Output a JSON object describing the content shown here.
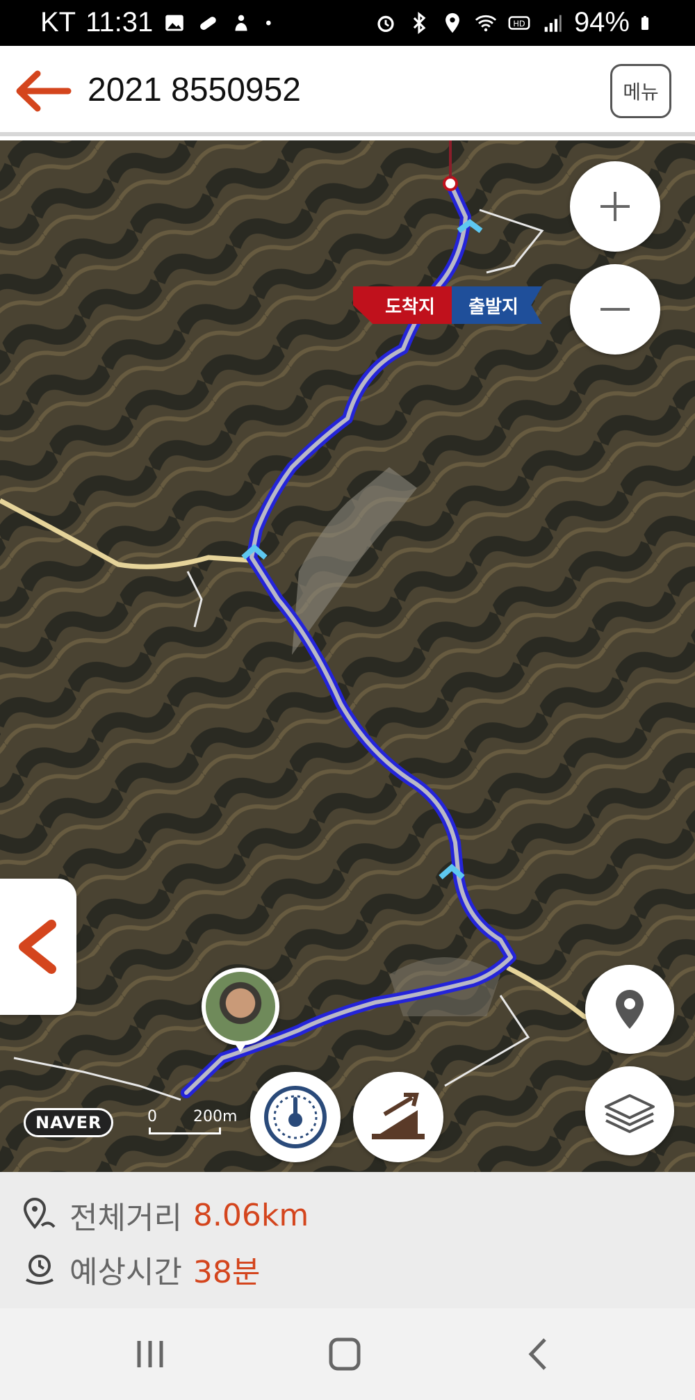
{
  "status_bar": {
    "carrier": "KT",
    "time": "11:31",
    "battery": "94%",
    "icons": [
      "image-icon",
      "pill-icon",
      "notification-icon",
      "dot-icon",
      "alarm-icon",
      "bluetooth-icon",
      "location-icon",
      "wifi-icon",
      "hd-icon",
      "signal-icon",
      "battery-icon"
    ]
  },
  "header": {
    "title": "2021 8550952",
    "menu_label": "메뉴",
    "accent_color": "#d4451d"
  },
  "map": {
    "flags": {
      "arrive": "도착지",
      "depart": "출발지"
    },
    "brand": "NAVER",
    "scale": {
      "start": "0",
      "end": "200m"
    },
    "route_color": "#2424d8",
    "controls": [
      "zoom-in",
      "zoom-out",
      "my-location",
      "layers",
      "speedometer",
      "elevation"
    ]
  },
  "info": {
    "distance_label": "전체거리",
    "distance_value": "8.06km",
    "time_label": "예상시간",
    "time_value": "38분"
  }
}
